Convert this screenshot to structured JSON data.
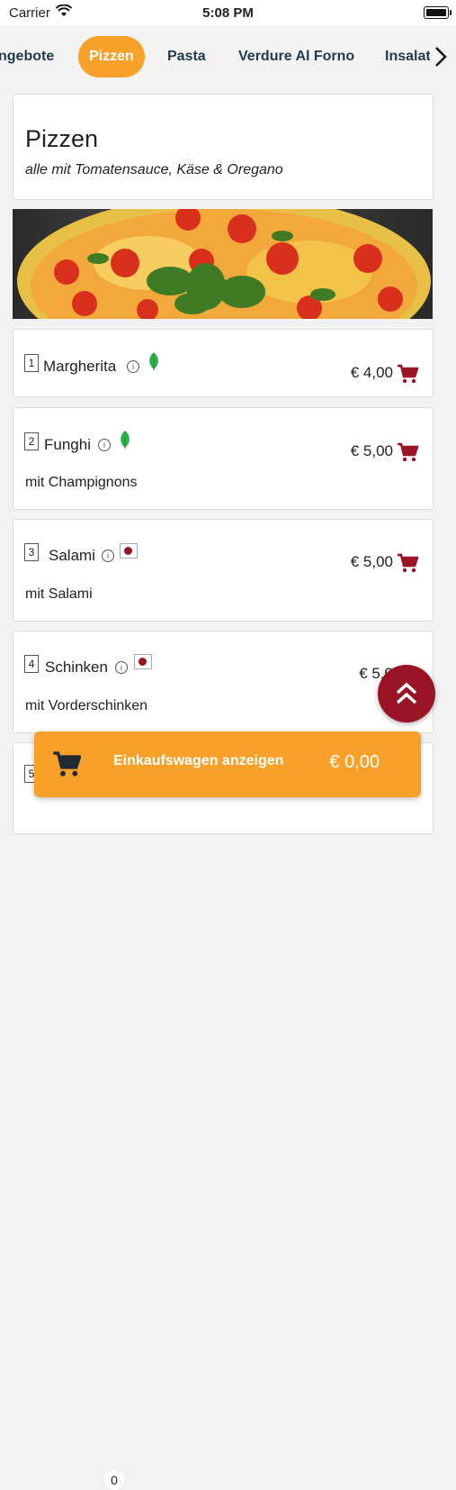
{
  "status_bar": {
    "carrier": "Carrier",
    "time": "5:08 PM"
  },
  "tabs": [
    {
      "label": "ngebote",
      "active": false
    },
    {
      "label": "Pizzen",
      "active": true
    },
    {
      "label": "Pasta",
      "active": false
    },
    {
      "label": "Verdure Al Forno",
      "active": false
    },
    {
      "label": "Insalat",
      "active": false
    }
  ],
  "section": {
    "title": "Pizzen",
    "subtitle": "alle mit Tomatensauce, Käse & Oregano"
  },
  "items": [
    {
      "number": "1",
      "name": "Margherita",
      "tag": "vegetarian-leaf-icon",
      "price": "€ 4,00",
      "description": ""
    },
    {
      "number": "2",
      "name": "Funghi",
      "tag": "vegetarian-leaf-icon",
      "price": "€ 5,00",
      "description": "mit Champignons"
    },
    {
      "number": "3",
      "name": "Salami",
      "tag": "meat-icon",
      "price": "€ 5,00",
      "description": "mit Salami"
    },
    {
      "number": "4",
      "name": "Schinken",
      "tag": "meat-icon",
      "price": "€ 5,0",
      "description": "mit Vorderschinken"
    },
    {
      "number": "5",
      "name": "",
      "tag": "",
      "price": "",
      "description": ""
    }
  ],
  "cart": {
    "count": "0",
    "label": "Einkaufswagen anzeigen",
    "total": "€ 0,00"
  },
  "colors": {
    "accent": "#f7a12a",
    "dark_red": "#9b1426",
    "tab_text": "#1f3b4d",
    "leaf": "#2bb34a"
  },
  "icons": {
    "info": "info-icon",
    "cart": "shopping-cart-icon",
    "scroll_top": "double-chevron-up-icon",
    "next": "chevron-right-icon"
  }
}
